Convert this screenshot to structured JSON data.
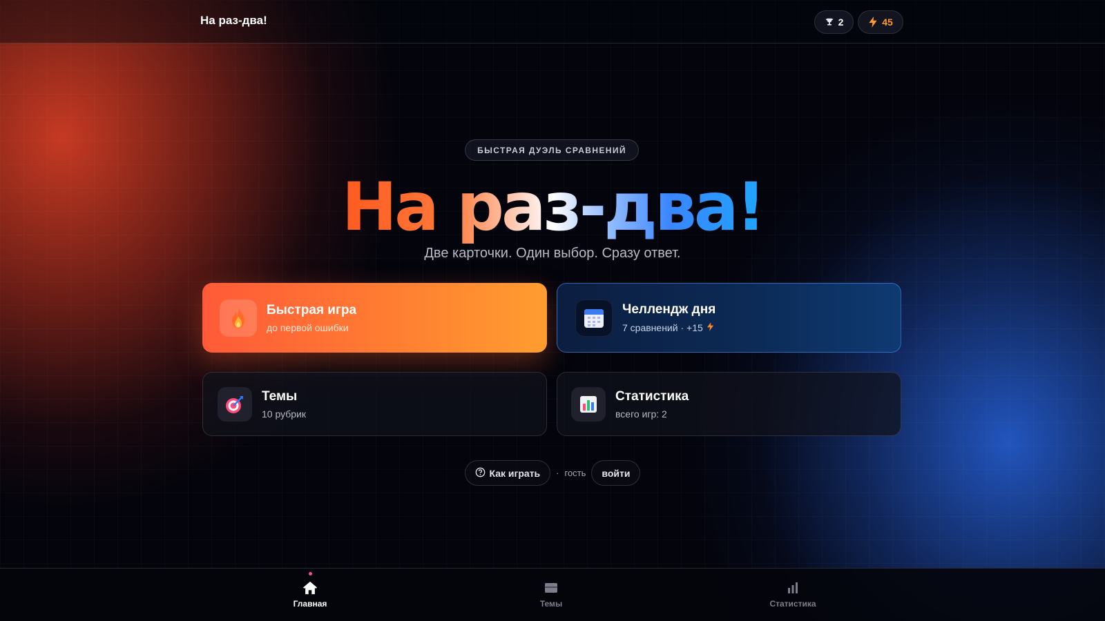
{
  "app": {
    "title": "На раз-два!"
  },
  "header": {
    "trophy_count": "2",
    "energy_count": "45",
    "colors": {
      "energy": "#ff9a2e"
    }
  },
  "hero": {
    "eyebrow": "БЫСТРАЯ ДУЭЛЬ СРАВНЕНИЙ",
    "title": "На раз-два!",
    "subtitle": "Две карточки. Один выбор. Сразу ответ."
  },
  "modes": {
    "quick": {
      "title": "Быстрая игра",
      "subtitle": "до первой ошибки",
      "icon": "fire-icon",
      "color": "#ff7a32"
    },
    "daily": {
      "title": "Челлендж дня",
      "subtitle": "7 сравнений · +15",
      "icon": "calendar-icon",
      "color": "#0e3a72"
    },
    "topics": {
      "title": "Темы",
      "subtitle": "10 рубрик",
      "icon": "target-icon"
    },
    "stats": {
      "title": "Статистика",
      "subtitle": "всего игр: 2",
      "icon": "bar-chart-icon"
    }
  },
  "footer": {
    "how_to_play": "Как играть",
    "separator": "·",
    "guest": "гость",
    "login": "войти"
  },
  "nav": {
    "items": [
      {
        "label": "Главная",
        "icon": "home-icon",
        "active": true
      },
      {
        "label": "Темы",
        "icon": "cards-icon",
        "active": false
      },
      {
        "label": "Статистика",
        "icon": "bar-chart-icon",
        "active": false
      }
    ]
  }
}
